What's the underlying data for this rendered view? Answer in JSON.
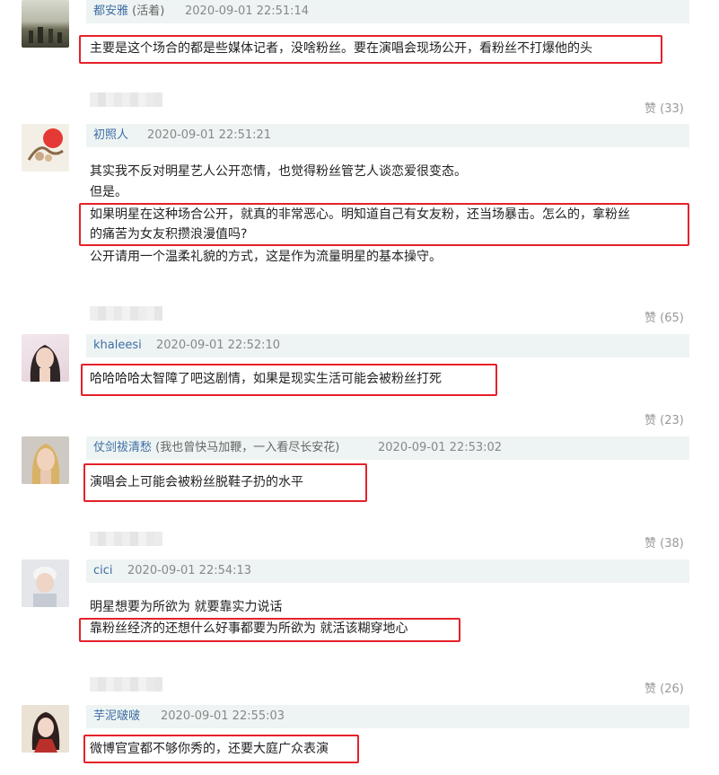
{
  "comments": [
    {
      "username": "都安雅",
      "username_suffix": "(活着)",
      "timestamp": "2020-09-01 22:51:14",
      "lines": [
        "主要是这个场合的都是些媒体记者，没啥粉丝。要在演唱会现场公开，看粉丝不打爆他的头"
      ],
      "likes": "赞 (33)"
    },
    {
      "username": "初照人",
      "timestamp": "2020-09-01 22:51:21",
      "lines": [
        "其实我不反对明星艺人公开恋情，也觉得粉丝管艺人谈恋爱很变态。",
        "但是。",
        "如果明星在这种场合公开，就真的非常恶心。明知道自己有女友粉，还当场暴击。怎么的，拿粉丝",
        "的痛苦为女友积攒浪漫值吗?",
        "公开请用一个温柔礼貌的方式，这是作为流量明星的基本操守。"
      ],
      "likes": "赞 (65)"
    },
    {
      "username": "khaleesi",
      "timestamp": "2020-09-01 22:52:10",
      "lines": [
        "哈哈哈哈太智障了吧这剧情，如果是现实生活可能会被粉丝打死"
      ],
      "likes": "赞 (23)"
    },
    {
      "username": "仗剑祓清愁",
      "username_suffix": "(我也曾快马加鞭，一入看尽长安花)",
      "timestamp": "2020-09-01 22:53:02",
      "lines": [
        "演唱会上可能会被粉丝脱鞋子扔的水平"
      ],
      "likes": "赞 (38)"
    },
    {
      "username": "cici",
      "timestamp": "2020-09-01 22:54:13",
      "lines": [
        "明星想要为所欲为 就要靠实力说话",
        "靠粉丝经济的还想什么好事都要为所欲为 就活该糊穿地心"
      ],
      "likes": "赞 (26)"
    },
    {
      "username": "芋泥啵啵",
      "timestamp": "2020-09-01 22:55:03",
      "lines": [
        "微博官宣都不够你秀的，还要大庭广众表演"
      ]
    }
  ]
}
